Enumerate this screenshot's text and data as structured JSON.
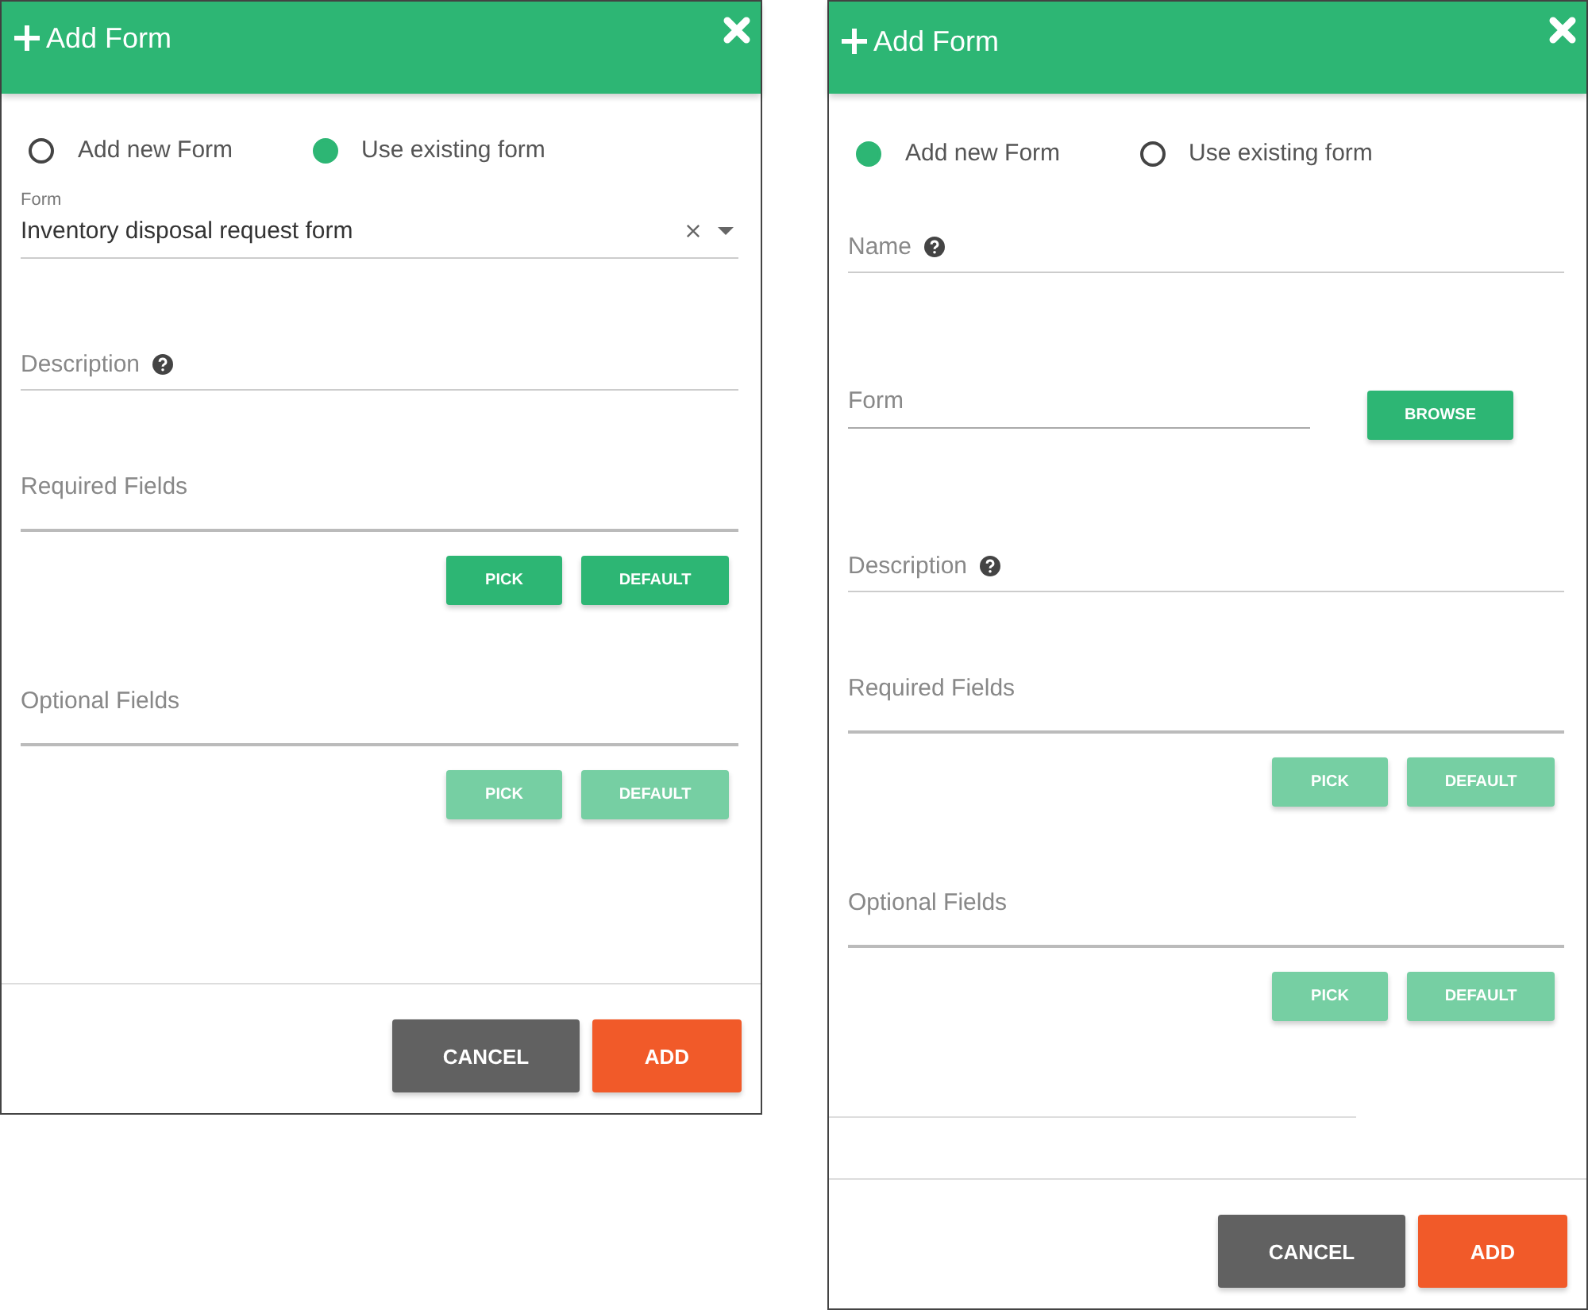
{
  "dialogs": [
    {
      "title": "Add Form",
      "options": [
        {
          "label": "Add new Form",
          "selected": false
        },
        {
          "label": "Use existing form",
          "selected": true
        }
      ],
      "fields": [
        {
          "kind": "select",
          "label": "Form",
          "value": "Inventory disposal request form"
        },
        {
          "kind": "text",
          "label": "Description",
          "help": true
        },
        {
          "kind": "picker",
          "label": "Required Fields",
          "buttons": [
            {
              "label": "PICK",
              "disabled": false
            },
            {
              "label": "DEFAULT",
              "disabled": false
            }
          ]
        },
        {
          "kind": "picker",
          "label": "Optional Fields",
          "buttons": [
            {
              "label": "PICK",
              "disabled": true
            },
            {
              "label": "DEFAULT",
              "disabled": true
            }
          ]
        }
      ],
      "buttons": [
        {
          "label": "CANCEL",
          "kind": "cancel"
        },
        {
          "label": "ADD",
          "kind": "confirm"
        }
      ]
    },
    {
      "title": "Add Form",
      "options": [
        {
          "label": "Add new Form",
          "selected": true
        },
        {
          "label": "Use existing form",
          "selected": false
        }
      ],
      "fields": [
        {
          "kind": "text",
          "label": "Name",
          "help": true
        },
        {
          "kind": "file",
          "label": "Form",
          "button": "BROWSE"
        },
        {
          "kind": "text",
          "label": "Description",
          "help": true
        },
        {
          "kind": "picker",
          "label": "Required Fields",
          "buttons": [
            {
              "label": "PICK",
              "disabled": true
            },
            {
              "label": "DEFAULT",
              "disabled": true
            }
          ]
        },
        {
          "kind": "picker",
          "label": "Optional Fields",
          "buttons": [
            {
              "label": "PICK",
              "disabled": true
            },
            {
              "label": "DEFAULT",
              "disabled": true
            }
          ]
        },
        {
          "kind": "rule"
        }
      ],
      "buttons": [
        {
          "label": "CANCEL",
          "kind": "cancel"
        },
        {
          "label": "ADD",
          "kind": "confirm"
        }
      ]
    }
  ]
}
